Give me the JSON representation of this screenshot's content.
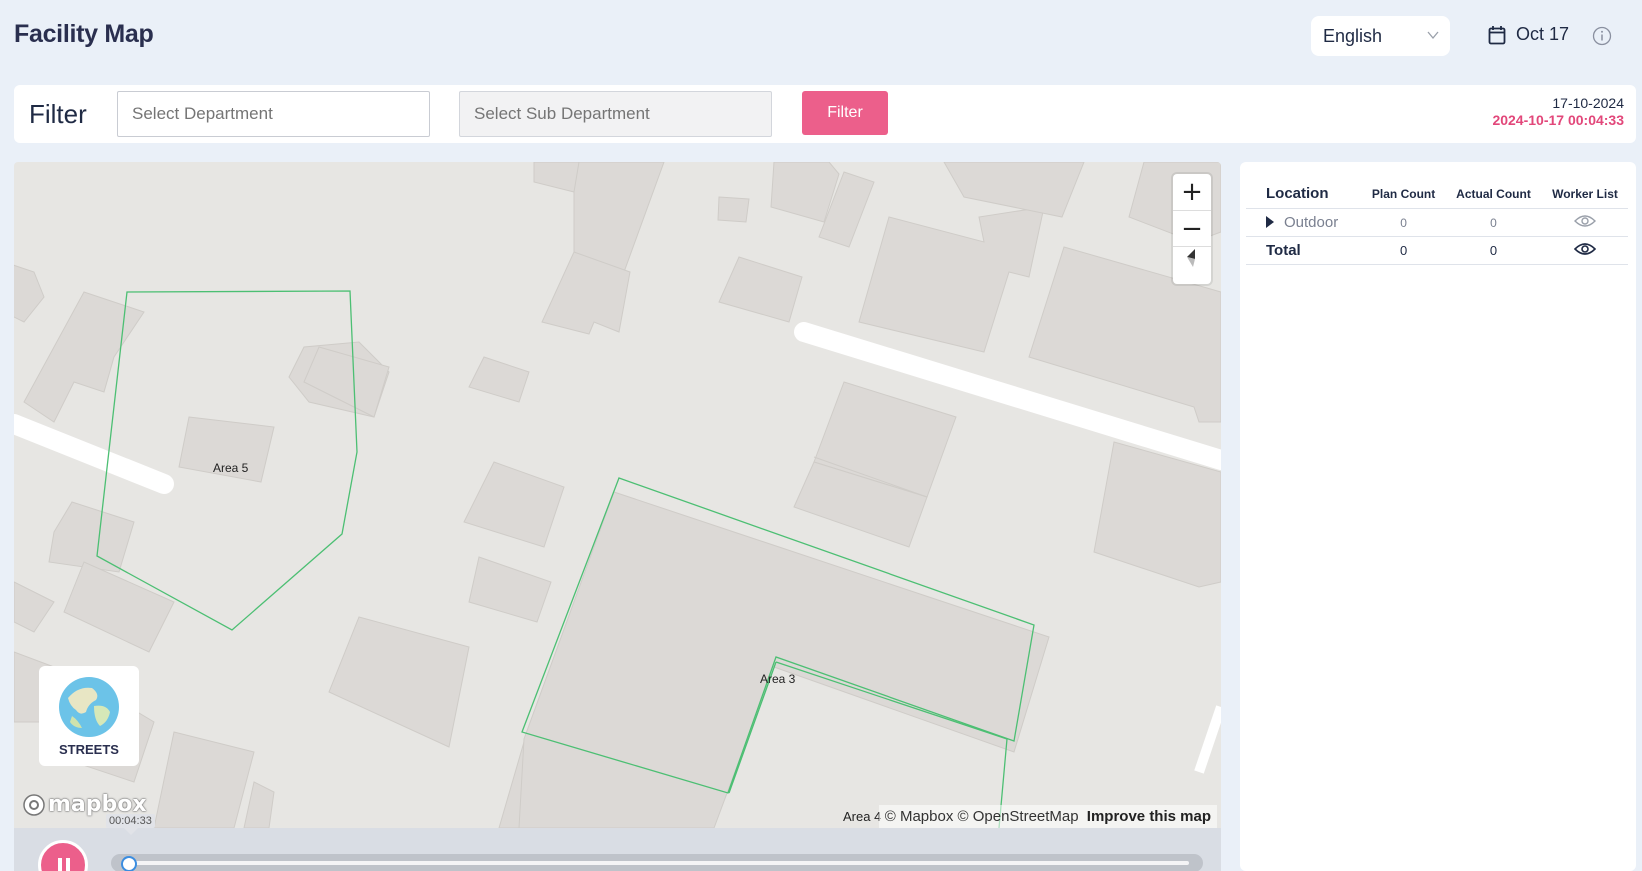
{
  "header": {
    "title": "Facility Map",
    "language": "English",
    "date": "Oct 17"
  },
  "filter": {
    "label": "Filter",
    "department_placeholder": "Select Department",
    "sub_department_placeholder": "Select Sub Department",
    "button_label": "Filter",
    "date_short": "17-10-2024",
    "datetime": "2024-10-17 00:04:33"
  },
  "map": {
    "area_labels": [
      "Area 5",
      "Area 3",
      "Area 4"
    ],
    "style_label": "STREETS",
    "logo": "mapbox",
    "attribution": "© Mapbox © OpenStreetMap",
    "improve_link": "Improve this map",
    "zoom_in": "+",
    "zoom_out": "−",
    "zone_color": "#4cbf73",
    "accent_color": "#ec5f8b"
  },
  "playback": {
    "current_time": "00:04:33",
    "progress": 0.0
  },
  "location_table": {
    "headers": [
      "Location",
      "Plan Count",
      "Actual Count",
      "Worker List"
    ],
    "rows": [
      {
        "location": "Outdoor",
        "plan": "0",
        "actual": "0"
      }
    ],
    "total": {
      "label": "Total",
      "plan": "0",
      "actual": "0"
    }
  }
}
